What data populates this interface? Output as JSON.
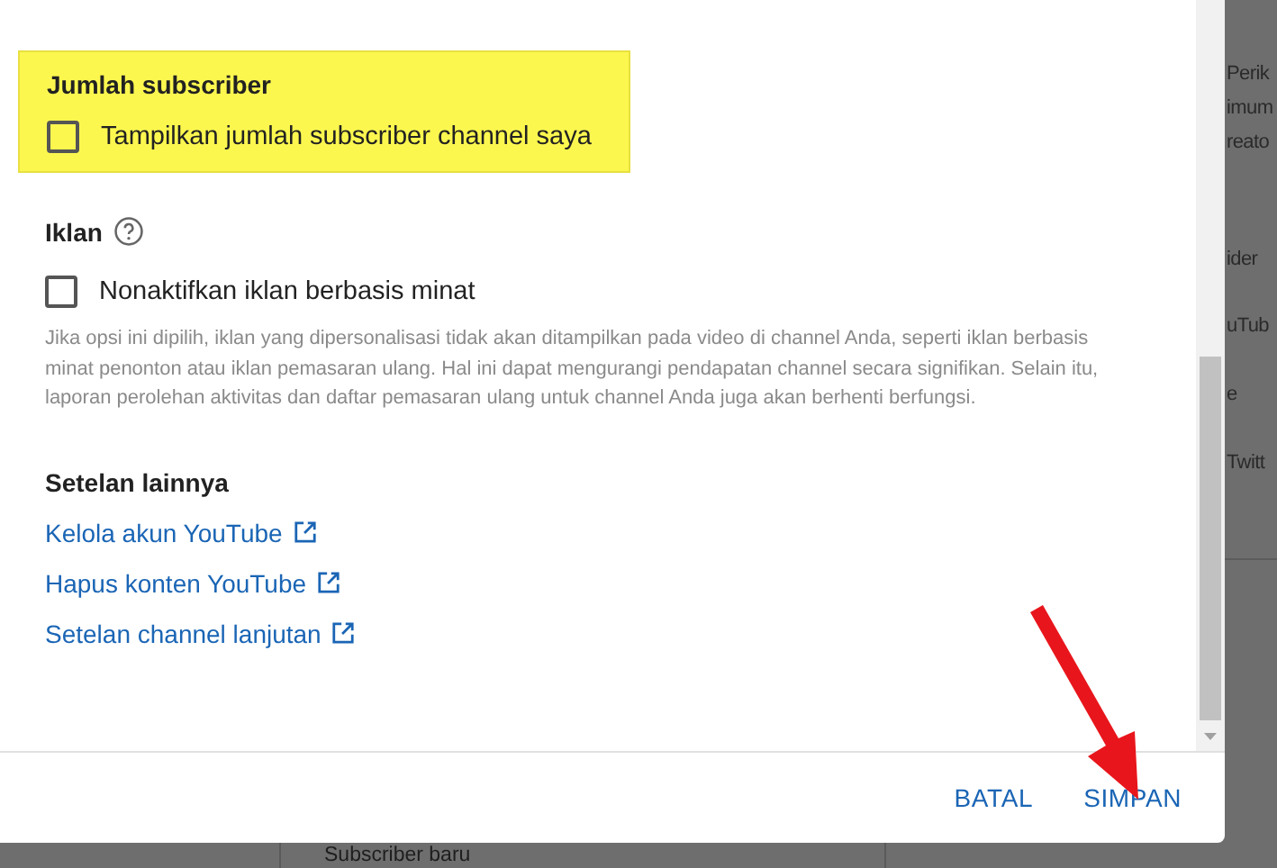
{
  "dialog": {
    "subscriber_section": {
      "title": "Jumlah subscriber",
      "highlighted": true,
      "checkbox": {
        "label": "Tampilkan jumlah subscriber channel saya",
        "checked": false
      }
    },
    "ads_section": {
      "title": "Iklan",
      "checkbox": {
        "label": "Nonaktifkan iklan berbasis minat",
        "checked": false
      },
      "description": "Jika opsi ini dipilih, iklan yang dipersonalisasi tidak akan ditampilkan pada video di channel Anda, seperti iklan berbasis minat penonton atau iklan pemasaran ulang. Hal ini dapat mengurangi pendapatan channel secara signifikan. Selain itu, laporan perolehan aktivitas dan daftar pemasaran ulang untuk channel Anda juga akan berhenti berfungsi."
    },
    "other_settings": {
      "title": "Setelan lainnya",
      "links": [
        {
          "label": "Kelola akun YouTube"
        },
        {
          "label": "Hapus konten YouTube"
        },
        {
          "label": "Setelan channel lanjutan"
        }
      ]
    },
    "buttons": [
      {
        "label": "BATAL"
      },
      {
        "label": "SIMPAN"
      }
    ]
  },
  "background": {
    "side_texts": [
      "Perik",
      "imum",
      "reato",
      "ider",
      "uTub",
      "e",
      "Twitt"
    ],
    "bottom_heading": "Subscriber baru"
  }
}
